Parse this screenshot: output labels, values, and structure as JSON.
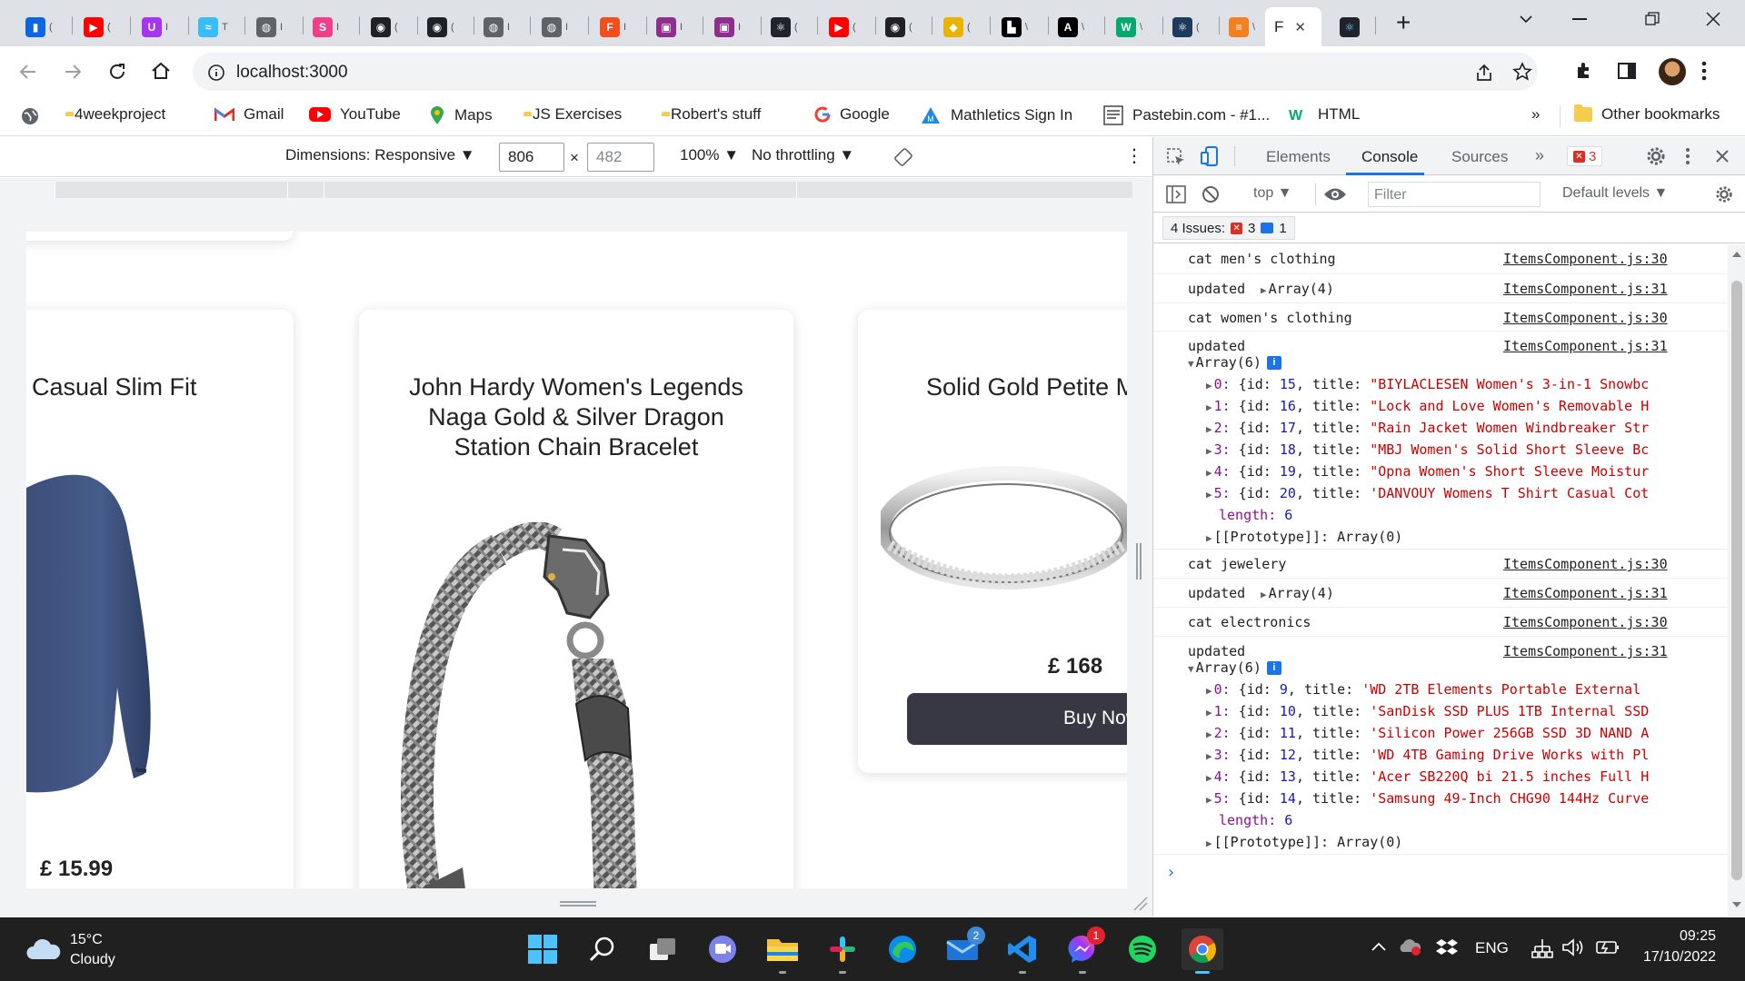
{
  "browser": {
    "tabs": [
      {
        "name": "trello",
        "color": "#0c66e4",
        "glyph": "▮",
        "label": "("
      },
      {
        "name": "youtube",
        "color": "#ff0000",
        "glyph": "▶",
        "label": "("
      },
      {
        "name": "udemy",
        "color": "#a435f0",
        "glyph": "U",
        "label": "I"
      },
      {
        "name": "tailwind",
        "color": "#38bdf8",
        "glyph": "≈",
        "label": "T"
      },
      {
        "name": "globe",
        "color": "#5f6368",
        "glyph": "◍",
        "label": "I"
      },
      {
        "name": "scrimba",
        "color": "#ef3e8a",
        "glyph": "S",
        "label": "I"
      },
      {
        "name": "github-1",
        "color": "#202124",
        "glyph": "◉",
        "label": "("
      },
      {
        "name": "github-2",
        "color": "#202124",
        "glyph": "◉",
        "label": "("
      },
      {
        "name": "globe-2",
        "color": "#5f6368",
        "glyph": "◍",
        "label": "I"
      },
      {
        "name": "globe-3",
        "color": "#5f6368",
        "glyph": "◍",
        "label": "I"
      },
      {
        "name": "figma",
        "color": "#f24e1e",
        "glyph": "F",
        "label": "I"
      },
      {
        "name": "web-1",
        "color": "#8e2f8e",
        "glyph": "▣",
        "label": "I"
      },
      {
        "name": "web-2",
        "color": "#8e2f8e",
        "glyph": "▣",
        "label": "I"
      },
      {
        "name": "react-1",
        "color": "#20232a",
        "glyph": "⚛",
        "label": "("
      },
      {
        "name": "youtube-2",
        "color": "#ff0000",
        "glyph": "▶",
        "label": "("
      },
      {
        "name": "github-3",
        "color": "#202124",
        "glyph": "◉",
        "label": "("
      },
      {
        "name": "mascot",
        "color": "#e8b400",
        "glyph": "◆",
        "label": "("
      },
      {
        "name": "dev-1",
        "color": "#000000",
        "glyph": "▙",
        "label": "\\"
      },
      {
        "name": "dev-2",
        "color": "#000000",
        "glyph": "A",
        "label": "\\"
      },
      {
        "name": "w3schools",
        "color": "#04aa6d",
        "glyph": "W",
        "label": "\\"
      },
      {
        "name": "react-2",
        "color": "#1f3a5f",
        "glyph": "⚛",
        "label": "("
      },
      {
        "name": "stackoverflow",
        "color": "#f48024",
        "glyph": "≡",
        "label": "\\"
      }
    ],
    "active_tab": {
      "label": "F",
      "close": "✕"
    },
    "after_tab": {
      "glyph": "⚛"
    },
    "new_tab": "+",
    "url": "localhost:3000",
    "bookmarks": [
      {
        "name": "4weekproject",
        "type": "folder"
      },
      {
        "name": "Gmail",
        "type": "gmail"
      },
      {
        "name": "YouTube",
        "type": "youtube"
      },
      {
        "name": "Maps",
        "type": "maps"
      },
      {
        "name": "JS Exercises",
        "type": "folder"
      },
      {
        "name": "Robert's stuff",
        "type": "folder"
      },
      {
        "name": "Google",
        "type": "google"
      },
      {
        "name": "Mathletics Sign In",
        "type": "mathletics"
      },
      {
        "name": "Pastebin.com - #1...",
        "type": "pastebin"
      },
      {
        "name": "HTML",
        "type": "w3"
      }
    ],
    "bookmarks_more": "»",
    "other_bookmarks": "Other bookmarks"
  },
  "device_toolbar": {
    "dimensions_label": "Dimensions: Responsive ▼",
    "width": "806",
    "times": "×",
    "height": "482",
    "zoom": "100% ▼",
    "throttling": "No throttling ▼",
    "more": "⋮"
  },
  "page": {
    "products": [
      {
        "title": "Casual Slim Fit",
        "price": "£ 15.99"
      },
      {
        "title": "John Hardy Women's Legends Naga Gold & Silver Dragon Station Chain Bracelet"
      },
      {
        "title": "Solid Gold Petite M",
        "price": "£ 168",
        "button": "Buy Now"
      }
    ]
  },
  "devtools": {
    "tabs": [
      "Elements",
      "Console",
      "Sources"
    ],
    "more_tabs": "»",
    "error_count": "3",
    "context": "top ▼",
    "filter_placeholder": "Filter",
    "levels": "Default levels ▼",
    "issues_label": "4 Issues:",
    "issues_errors": "3",
    "issues_info": "1",
    "prompt": "›",
    "console": {
      "logs": [
        {
          "msg": "cat men's clothing",
          "src": "ItemsComponent.js:30"
        },
        {
          "msg": "updated",
          "arr": "Array(4)",
          "src": "ItemsComponent.js:31"
        },
        {
          "msg": "cat women's clothing",
          "src": "ItemsComponent.js:30"
        },
        {
          "msg": "updated",
          "src": "ItemsComponent.js:31"
        },
        {
          "msg": "cat jewelery",
          "src": "ItemsComponent.js:30"
        },
        {
          "msg": "updated",
          "arr": "Array(4)",
          "src": "ItemsComponent.js:31"
        },
        {
          "msg": "cat electronics",
          "src": "ItemsComponent.js:30"
        },
        {
          "msg": "updated",
          "src": "ItemsComponent.js:31"
        }
      ],
      "array_header": "Array(6)",
      "women_items": [
        {
          "idx": "0",
          "id": "15",
          "title": "\"BIYLACLESEN Women's 3-in-1 Snowbc"
        },
        {
          "idx": "1",
          "id": "16",
          "title": "\"Lock and Love Women's Removable H"
        },
        {
          "idx": "2",
          "id": "17",
          "title": "\"Rain Jacket Women Windbreaker Str"
        },
        {
          "idx": "3",
          "id": "18",
          "title": "\"MBJ Women's Solid Short Sleeve Bc"
        },
        {
          "idx": "4",
          "id": "19",
          "title": "\"Opna Women's Short Sleeve Moistur"
        },
        {
          "idx": "5",
          "id": "20",
          "title": "'DANVOUY Womens T Shirt Casual Cot"
        }
      ],
      "electronics_items": [
        {
          "idx": "0",
          "id": "9",
          "title": "'WD 2TB Elements Portable External"
        },
        {
          "idx": "1",
          "id": "10",
          "title": "'SanDisk SSD PLUS 1TB Internal SSD"
        },
        {
          "idx": "2",
          "id": "11",
          "title": "'Silicon Power 256GB SSD 3D NAND A"
        },
        {
          "idx": "3",
          "id": "12",
          "title": "'WD 4TB Gaming Drive Works with Pl"
        },
        {
          "idx": "4",
          "id": "13",
          "title": "'Acer SB220Q bi 21.5 inches Full H"
        },
        {
          "idx": "5",
          "id": "14",
          "title": "'Samsung 49-Inch CHG90 144Hz Curve"
        }
      ],
      "length_label": "length",
      "length_value": "6",
      "prototype": "[[Prototype]]: Array(0)"
    }
  },
  "taskbar": {
    "weather_temp": "15°C",
    "weather_desc": "Cloudy",
    "language": "ENG",
    "time": "09:25",
    "date": "17/10/2022",
    "mail_badge": "2",
    "messenger_badge": "1"
  },
  "colors": {
    "accent": "#1a73e8",
    "error": "#d93025",
    "buy_button": "#383844",
    "taskbar": "#202020"
  }
}
